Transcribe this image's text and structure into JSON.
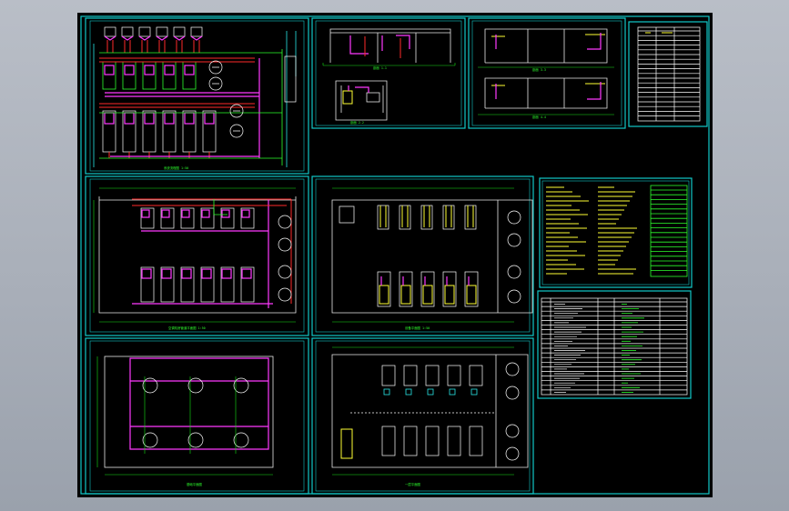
{
  "colors": {
    "background": "#000000",
    "frame": "#11c9c9",
    "wall": "#e8e8e8",
    "dimension": "#17e017",
    "pipe_red": "#ff2a2a",
    "pipe_magenta": "#ff38ff",
    "pipe_yellow": "#ffff33"
  },
  "sheets": [
    {
      "id": "system-diagram",
      "kind": "piping-system-schematic"
    },
    {
      "id": "section-1",
      "kind": "section-view"
    },
    {
      "id": "section-2",
      "kind": "section-view"
    },
    {
      "id": "material-table-top",
      "kind": "table"
    },
    {
      "id": "plan-piping",
      "kind": "floor-plan"
    },
    {
      "id": "plan-equipment",
      "kind": "floor-plan"
    },
    {
      "id": "notes",
      "kind": "design-notes"
    },
    {
      "id": "equipment-list",
      "kind": "table"
    },
    {
      "id": "foundation-plan",
      "kind": "floor-plan"
    },
    {
      "id": "plan-ground",
      "kind": "floor-plan"
    }
  ]
}
